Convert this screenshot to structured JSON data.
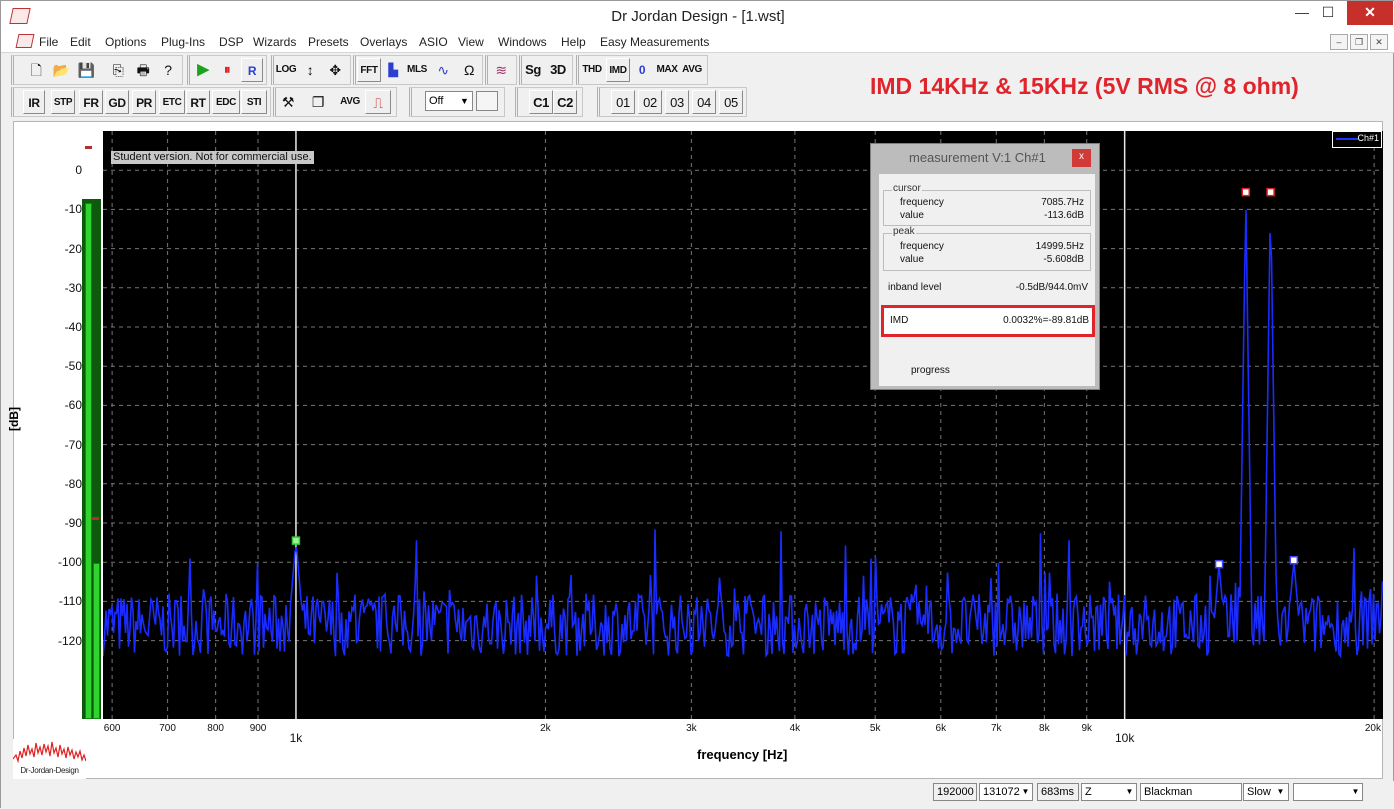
{
  "window": {
    "title": "Dr Jordan Design - [1.wst]",
    "controls": {
      "minimize": "—",
      "maximize": "☐",
      "close": "✕"
    }
  },
  "menu": [
    "File",
    "Edit",
    "Options",
    "Plug-Ins",
    "DSP",
    "Wizards",
    "Presets",
    "Overlays",
    "ASIO",
    "View",
    "Windows",
    "Help",
    "Easy Measurements"
  ],
  "mdi_controls": {
    "minimize": "–",
    "restore": "❐",
    "close": "✕"
  },
  "toolbar1": {
    "buttons": [
      {
        "name": "new-file-icon",
        "label": "🗋"
      },
      {
        "name": "open-folder-icon",
        "label": "📂"
      },
      {
        "name": "save-icon",
        "label": "💾"
      },
      {
        "name": "copy-icon",
        "label": "⎘"
      },
      {
        "name": "print-icon",
        "label": "🖶"
      },
      {
        "name": "help-icon",
        "label": "?"
      },
      {
        "name": "play-icon",
        "label": "▶"
      },
      {
        "name": "pause-icon",
        "label": "⏸"
      },
      {
        "name": "record-button",
        "label": "R"
      },
      {
        "name": "log-button",
        "label": "LOG"
      },
      {
        "name": "vertical-zoom-icon",
        "label": "↕"
      },
      {
        "name": "move-icon",
        "label": "✥"
      },
      {
        "name": "fft-button",
        "label": "FFT"
      },
      {
        "name": "bar-chart-icon",
        "label": "▙"
      },
      {
        "name": "mls-button",
        "label": "MLS"
      },
      {
        "name": "waveform-icon",
        "label": "∿"
      },
      {
        "name": "ohm-icon",
        "label": "Ω"
      },
      {
        "name": "overlay-wave-icon",
        "label": "≋"
      },
      {
        "name": "sg-button",
        "label": "Sg"
      },
      {
        "name": "3d-button",
        "label": "3D"
      },
      {
        "name": "thd-button",
        "label": "THD"
      },
      {
        "name": "imd-button",
        "label": "IMD"
      },
      {
        "name": "zero-button",
        "label": "0"
      },
      {
        "name": "max-button",
        "label": "MAX"
      },
      {
        "name": "avg-button",
        "label": "AVG"
      }
    ]
  },
  "toolbar2": {
    "buttons": [
      "IR",
      "STP",
      "FR",
      "GD",
      "PR",
      "ETC",
      "RT",
      "EDC",
      "STI"
    ],
    "tool_icons": [
      {
        "name": "hammer-icon",
        "label": "⚒"
      },
      {
        "name": "copy-window-icon",
        "label": "❐"
      }
    ],
    "avg_label": "AVG",
    "pulse_icon": "⎍",
    "select_value": "Off",
    "channels": [
      "C1",
      "C2"
    ],
    "presets": [
      "01",
      "02",
      "03",
      "04",
      "05"
    ]
  },
  "headline": "IMD 14KHz & 15KHz (5V RMS @ 8 ohm)",
  "plot": {
    "banner": "Student version. Not for commercial use.",
    "legend": "Ch#1",
    "y_title": "[dB]",
    "x_title": "frequency [Hz]"
  },
  "chart_data": {
    "type": "line",
    "title": "",
    "xlabel": "frequency [Hz]",
    "ylabel": "[dB]",
    "x_scale": "log",
    "xlim": [
      585,
      20500
    ],
    "ylim": [
      -140,
      10
    ],
    "grid": true,
    "y_ticks": [
      0,
      -10,
      -20,
      -30,
      -40,
      -50,
      -60,
      -70,
      -80,
      -90,
      -100,
      -110,
      -120
    ],
    "x_ticks": [
      600,
      700,
      800,
      900,
      1000,
      2000,
      3000,
      4000,
      5000,
      6000,
      7000,
      8000,
      9000,
      10000,
      20000
    ],
    "x_tick_labels": [
      "600",
      "700",
      "800",
      "900",
      "1k",
      "2k",
      "3k",
      "4k",
      "5k",
      "6k",
      "7k",
      "8k",
      "9k",
      "10k",
      "20k"
    ],
    "series": [
      {
        "name": "Ch#1",
        "color": "#1a2cff",
        "peaks": [
          {
            "x": 1000,
            "y": -94.5
          },
          {
            "x": 13000,
            "y": -100.5
          },
          {
            "x": 14000,
            "y": -5.6
          },
          {
            "x": 15000,
            "y": -5.6
          },
          {
            "x": 16000,
            "y": -99.5
          }
        ],
        "noise_floor": -113
      }
    ],
    "cursor_markers": [
      1000,
      10000
    ]
  },
  "measurement": {
    "title": "measurement V:1 Ch#1",
    "close": "x",
    "cursor_legend": "cursor",
    "cursor_frequency_label": "frequency",
    "cursor_frequency": "7085.7Hz",
    "cursor_value_label": "value",
    "cursor_value": "-113.6dB",
    "peak_legend": "peak",
    "peak_frequency_label": "frequency",
    "peak_frequency": "14999.5Hz",
    "peak_value_label": "value",
    "peak_value": "-5.608dB",
    "inband_label": "inband level",
    "inband_value": "-0.5dB/944.0mV",
    "imd_label": "IMD",
    "imd_value": "0.0032%=-89.81dB",
    "progress_label": "progress"
  },
  "logo_text": "Dr-Jordan-Design",
  "status": {
    "sample_rate": "192000",
    "fft_size": "131072",
    "duration": "683ms",
    "weighting": "Z",
    "window": "Blackman",
    "speed": "Slow",
    "extra": ""
  }
}
